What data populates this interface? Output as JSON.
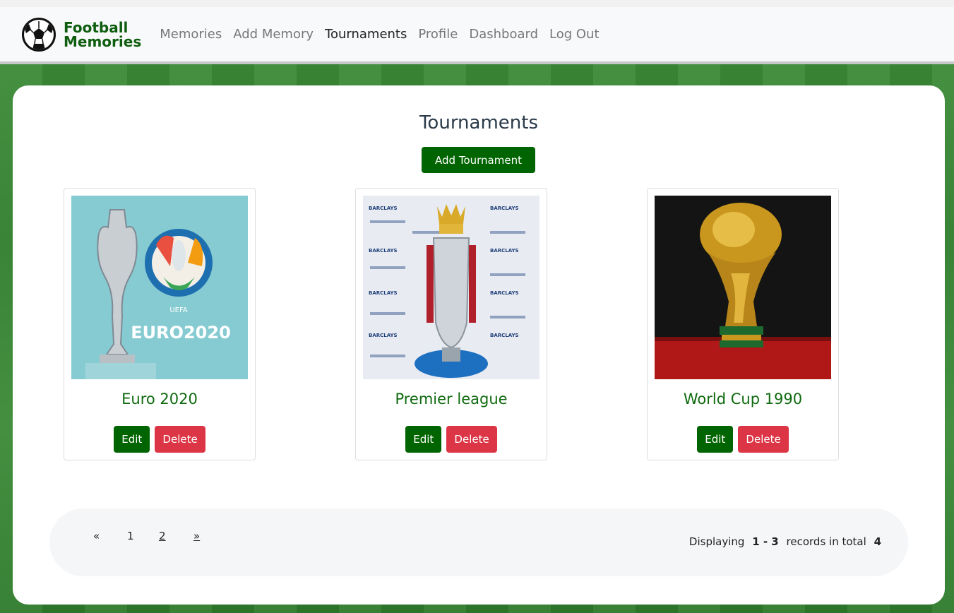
{
  "app": {
    "brand_line1": "Football",
    "brand_line2": "Memories",
    "brand_color": "#0f5d0f"
  },
  "nav": {
    "items": [
      {
        "label": "Memories",
        "active": false
      },
      {
        "label": "Add Memory",
        "active": false
      },
      {
        "label": "Tournaments",
        "active": true
      },
      {
        "label": "Profile",
        "active": false
      },
      {
        "label": "Dashboard",
        "active": false
      },
      {
        "label": "Log Out",
        "active": false
      }
    ]
  },
  "page": {
    "title": "Tournaments",
    "add_button": "Add Tournament"
  },
  "tournaments": [
    {
      "name": "Euro 2020",
      "image_label": "EURO2020",
      "image_sub": "UEFA",
      "edit": "Edit",
      "delete": "Delete"
    },
    {
      "name": "Premier league",
      "image_label": "BARCLAYS",
      "edit": "Edit",
      "delete": "Delete"
    },
    {
      "name": "World Cup 1990",
      "edit": "Edit",
      "delete": "Delete"
    }
  ],
  "pagination": {
    "prev": "«",
    "pages": [
      "1",
      "2"
    ],
    "next": "»",
    "summary_prefix": "Displaying",
    "range": "1 - 3",
    "summary_mid": "records in total",
    "total": "4"
  },
  "colors": {
    "primary_green": "#006400",
    "danger_red": "#dc3545"
  }
}
